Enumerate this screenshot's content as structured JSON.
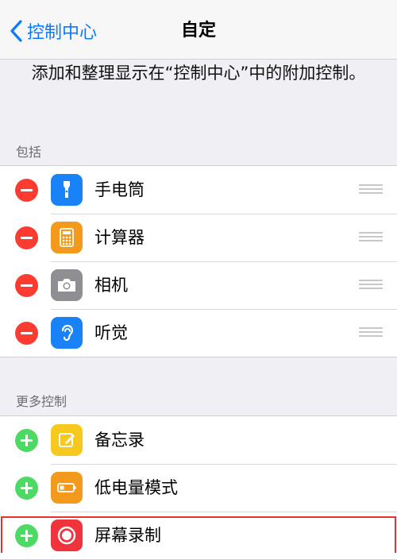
{
  "nav": {
    "back_label": "控制中心",
    "title": "自定"
  },
  "description": "添加和整理显示在“控制中心”中的附加控制。",
  "included": {
    "header": "包括",
    "items": [
      {
        "label": "手电筒",
        "icon": "flashlight-icon",
        "color": "#1a82f7"
      },
      {
        "label": "计算器",
        "icon": "calculator-icon",
        "color": "#f39a1c"
      },
      {
        "label": "相机",
        "icon": "camera-icon",
        "color": "#8e8e93"
      },
      {
        "label": "听觉",
        "icon": "ear-icon",
        "color": "#1a82f7"
      }
    ]
  },
  "more": {
    "header": "更多控制",
    "items": [
      {
        "label": "备忘录",
        "icon": "notes-icon",
        "color": "#f7c81e"
      },
      {
        "label": "低电量模式",
        "icon": "battery-icon",
        "color": "#f39a1c"
      },
      {
        "label": "屏幕录制",
        "icon": "screen-record-icon",
        "color": "#f0333d"
      }
    ]
  },
  "colors": {
    "accent": "#0a7aff",
    "remove": "#fe3b30",
    "add": "#4cd964",
    "highlight": "#e8322f"
  }
}
